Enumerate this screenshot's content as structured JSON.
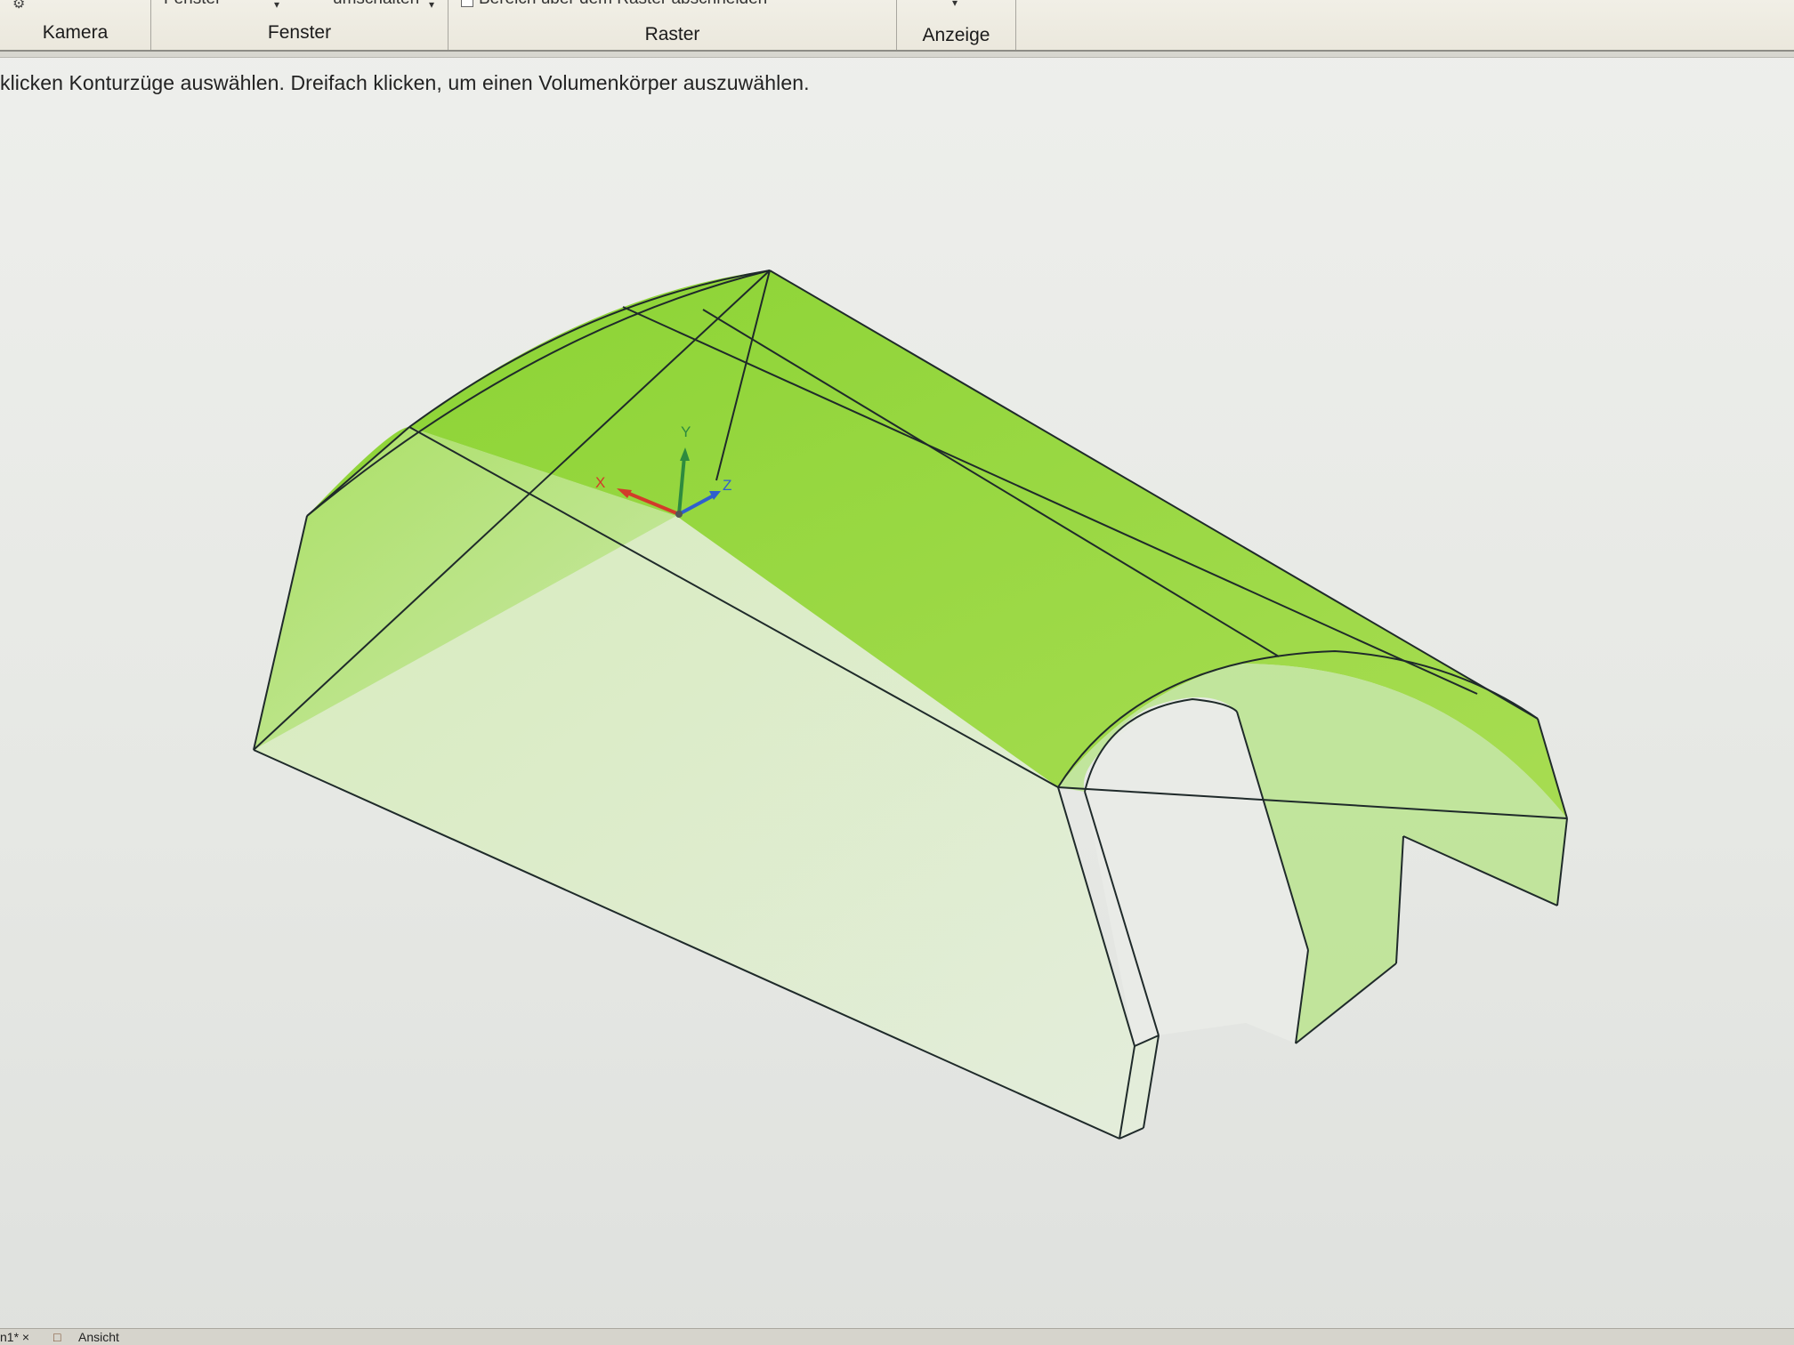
{
  "ribbon": {
    "groups": [
      {
        "label": "Kamera"
      },
      {
        "label": "Fenster"
      },
      {
        "label": "Raster"
      },
      {
        "label": "Anzeige"
      }
    ],
    "cut_top_texts": {
      "fenster_button": "Fenster",
      "umschalten_button": "umschalten",
      "raster_checkbox": "Bereich über dem Raster abschneiden"
    }
  },
  "status": {
    "prompt": "klicken Konturzüge auswählen. Dreifach klicken, um einen Volumenkörper auszuwählen."
  },
  "viewport": {
    "axes": {
      "x_label": "X",
      "y_label": "Y",
      "z_label": "Z",
      "x_color": "#d23b2a",
      "y_color": "#2e8b3e",
      "z_color": "#2f5fcf"
    },
    "model_color": "#8fd63a",
    "model_edge_color": "#1f2a2a"
  },
  "bottom_tabs": [
    {
      "label": "n1* ×"
    },
    {
      "label": "Ansicht"
    }
  ]
}
